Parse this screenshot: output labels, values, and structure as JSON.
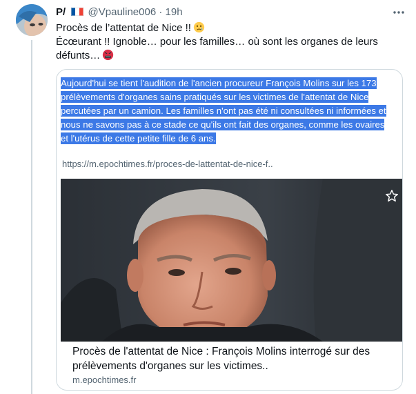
{
  "tweet": {
    "author_name": "P/",
    "author_handle": "@Vpauline006",
    "separator": "·",
    "timestamp": "19h",
    "more_icon": "more-horizontal-icon",
    "lines": [
      "Procès de l’attentat de Nice !!",
      "Écœurant !! Ignoble… pour les familles… où sont les organes de leurs défunts…"
    ]
  },
  "card": {
    "quote_text": "Aujourd'hui se tient l'audition de l'ancien procureur François Molins sur les 173 prélèvements d'organes sains pratiqués sur les victimes de l'attentat de Nice percutées par un camion. Les familles n'ont pas été ni consultées ni informées et nous ne savons pas à ce stade ce qu'ils ont fait des organes, comme les ovaires et l'utérus de cette petite fille de 6 ans.",
    "link_url": "https://m.epochtimes.fr/proces-de-lattentat-de-nice-f..",
    "title": "Procès de l'attentat de Nice : François Molins interrogé sur des prélèvements d'organes sur les victimes..",
    "domain": "m.epochtimes.fr",
    "highlight_color": "#3c79e6"
  }
}
